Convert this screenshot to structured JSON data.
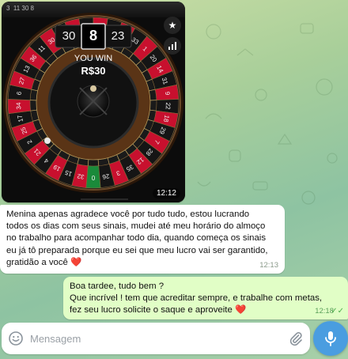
{
  "media": {
    "time": "12:12",
    "roulette": {
      "previous_number": "30",
      "current_number": "8",
      "next_number": "23",
      "win_label": "YOU WIN",
      "win_amount": "R$30",
      "wheel_numbers": [
        "0",
        "32",
        "15",
        "19",
        "4",
        "21",
        "2",
        "25",
        "17",
        "34",
        "6",
        "27",
        "13",
        "36",
        "11",
        "30",
        "8",
        "23",
        "10",
        "5",
        "24",
        "16",
        "33",
        "1",
        "20",
        "14",
        "31",
        "9",
        "22",
        "18",
        "29",
        "7",
        "28",
        "12",
        "35",
        "3",
        "26"
      ]
    },
    "top_strip": "3  11 30 8"
  },
  "incoming": {
    "lines": [
      "Menina apenas agradece você por tudo tudo, estou lucrando",
      "todos os dias com seus sinais, mudei até meu horário do almoço",
      "no trabalho para acompanhar todo dia, quando começa os sinais",
      "eu já tô preparada porque eu sei que meu lucro vai ser garantido,",
      "gratidão a você"
    ],
    "emoji": "❤️",
    "time": "12:13"
  },
  "outgoing": {
    "lines": [
      "Boa tardee, tudo bem ?",
      "Que incrível ! tem que acreditar sempre, e trabalhe com metas,",
      "fez seu lucro solicite o saque e aproveite"
    ],
    "emoji": "❤️",
    "time": "12:18"
  },
  "composer": {
    "placeholder": "Mensagem"
  },
  "icons": {
    "emoji": "emoji-icon",
    "attach": "paperclip-icon",
    "mic": "microphone-icon",
    "star": "star-icon",
    "stats": "stats-icon",
    "read": "double-check-icon"
  },
  "colors": {
    "incoming_bg": "#ffffff",
    "outgoing_bg": "#e1fec6",
    "accent": "#4a9de0",
    "roulette_red": "#c8102e",
    "roulette_green": "#1a8a3a"
  }
}
